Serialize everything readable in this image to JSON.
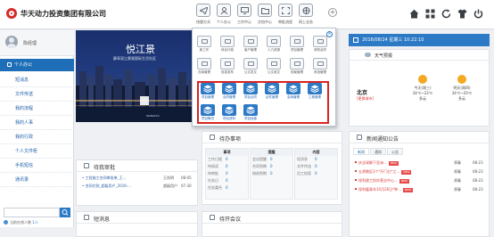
{
  "header": {
    "company": "华天动力投资集团有限公司",
    "quick_nav": [
      {
        "icon": "send-icon",
        "label": "快捷方式"
      },
      {
        "icon": "person-icon",
        "label": "个人办公"
      },
      {
        "icon": "monitor-icon",
        "label": "工作中心"
      },
      {
        "icon": "folder-icon",
        "label": "文档中心"
      },
      {
        "icon": "scan-icon",
        "label": "审批流程"
      },
      {
        "icon": "network-icon",
        "label": "网上业务"
      }
    ],
    "top_right_icons": [
      "home-icon",
      "grid-icon",
      "refresh-icon",
      "shirt-icon",
      "power-icon"
    ]
  },
  "sidebar": {
    "username": "陈经理",
    "section": "个人办公",
    "items": [
      "短消息",
      "文件传送",
      "我的流程",
      "我的人事",
      "我的行政",
      "个人文件柜",
      "手机短信",
      "通讯录"
    ],
    "search_placeholder": "",
    "online_text": "当前在线人数",
    "online_count": "1人"
  },
  "banner": {
    "title": "悦江景",
    "subtitle": "静享双江景观国际生活社区",
    "brand": "WANGHAI"
  },
  "app_popup": {
    "row1": [
      "新工作",
      "综合行政",
      "客户管理",
      "人力资源",
      "项目管理",
      "采购合同"
    ],
    "row2": [
      "仓库管理",
      "信息发布",
      "公文发文",
      "公文收文",
      "档案管理",
      "系统管理"
    ],
    "row3": [
      "项目管理",
      "合同管理",
      "项目合同",
      "证件管理",
      "会商管理",
      "工程管理"
    ],
    "row4": [
      "项目概况",
      "项目资料",
      "项目经营"
    ]
  },
  "date_bar": "2016/08/24  星期三  10:22:10",
  "weather": {
    "title": "天气预报",
    "city": "北京",
    "switch_city": "[更换城市]",
    "today": {
      "label": "今天(周三)",
      "temp": "34℃~22℃",
      "desc": "多云"
    },
    "tomorrow": {
      "label": "明天(周四)",
      "temp": "34℃~20℃",
      "desc": "多云"
    }
  },
  "approval": {
    "title": "待我审批",
    "rows": [
      {
        "title": "• 工程施工合同审批单_王...",
        "user": "王尚明",
        "date": "08-05"
      },
      {
        "title": "• 合同付款_超级用户_2016-...",
        "user": "超级用户",
        "date": "07-30"
      }
    ]
  },
  "todo": {
    "title": "待办事项",
    "columns": [
      {
        "header": "事项",
        "rows": [
          [
            "工作日报",
            "0"
          ],
          [
            "待阅读",
            "0"
          ],
          [
            "待审批",
            "0"
          ],
          [
            "任务日",
            "0"
          ],
          [
            "任务委托",
            "0"
          ]
        ]
      },
      {
        "header": "提醒",
        "rows": [
          [
            "会议提醒",
            "0"
          ],
          [
            "合同到期",
            "0"
          ],
          [
            "借阅到期",
            "0"
          ]
        ]
      },
      {
        "header": "内容",
        "rows": [
          [
            "短消息",
            "0"
          ],
          [
            "文件传送",
            "0"
          ],
          [
            "员工档案",
            "0"
          ]
        ]
      }
    ]
  },
  "news": {
    "title": "新闻通知公告",
    "tabs": [
      "新闻",
      "通知",
      "公告"
    ],
    "rows": [
      {
        "title": "庆全球解下亚洲...",
        "badge": "NEW",
        "user": "郑春",
        "date": "08-23"
      },
      {
        "title": "五肃教区3个*开门红*之...",
        "badge": "NEW",
        "user": "郑春",
        "date": "08-23"
      },
      {
        "title": "保利建工投炸营业中心...",
        "badge": "NEW",
        "user": "郑春",
        "date": "08-23"
      },
      {
        "title": "保利暖青年10月26日*种...",
        "badge": "NEW",
        "user": "郑春",
        "date": "08-23"
      }
    ]
  },
  "sms": {
    "title": "短消息"
  },
  "meeting": {
    "title": "待开会议"
  }
}
